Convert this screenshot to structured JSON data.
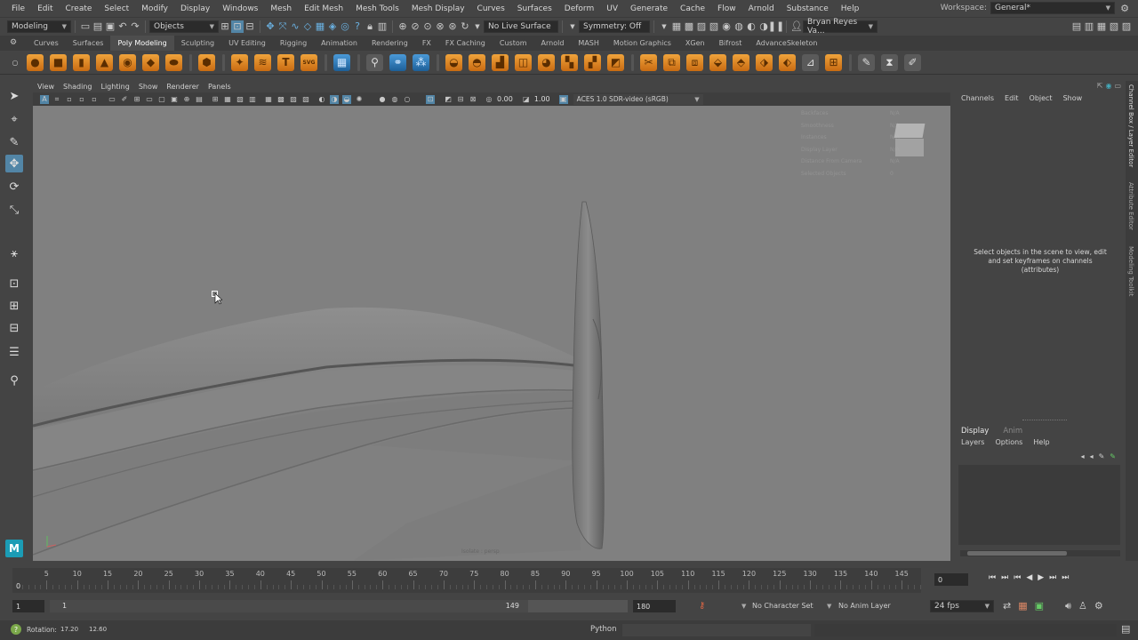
{
  "menubar": {
    "items": [
      "File",
      "Edit",
      "Create",
      "Select",
      "Modify",
      "Display",
      "Windows",
      "Mesh",
      "Edit Mesh",
      "Mesh Tools",
      "Mesh Display",
      "Curves",
      "Surfaces",
      "Deform",
      "UV",
      "Generate",
      "Cache",
      "Flow",
      "Arnold",
      "Substance",
      "Help"
    ],
    "workspace_label": "Workspace:",
    "workspace_value": "General*"
  },
  "statusline": {
    "menu_set": "Modeling",
    "selection_mode": "Objects",
    "live_surface": "No Live Surface",
    "symmetry": "Symmetry: Off",
    "user": "Bryan Reyes Va..."
  },
  "shelf": {
    "tabs": [
      "Curves",
      "Surfaces",
      "Poly Modeling",
      "Sculpting",
      "UV Editing",
      "Rigging",
      "Animation",
      "Rendering",
      "FX",
      "FX Caching",
      "Custom",
      "Arnold",
      "MASH",
      "Motion Graphics",
      "XGen",
      "Bifrost",
      "AdvanceSkeleton"
    ],
    "active_tab": "Poly Modeling",
    "text_icon": "T",
    "svg_icon": "SVG"
  },
  "panel": {
    "menus": [
      "View",
      "Shading",
      "Lighting",
      "Show",
      "Renderer",
      "Panels"
    ],
    "exposure": "0.00",
    "gamma": "1.00",
    "color_space": "ACES 1.0 SDR-video (sRGB)",
    "camera_label": "Isolate : persp"
  },
  "hud": {
    "rows": [
      "Backfaces",
      "Smoothness",
      "Instances",
      "Display Layer",
      "Distance From Camera",
      "Selected Objects"
    ],
    "values": [
      "N/A",
      "N/A",
      "N/A",
      "N/A",
      "N/A",
      "0"
    ]
  },
  "channelbox": {
    "menus": [
      "Channels",
      "Edit",
      "Object",
      "Show"
    ],
    "message": "Select objects in the scene to view, edit and set keyframes on channels (attributes)",
    "layer_tabs": [
      "Display",
      "Anim"
    ],
    "layer_menus": [
      "Layers",
      "Options",
      "Help"
    ],
    "vertical_tabs": [
      "Channel Box / Layer Editor",
      "Attribute Editor",
      "Modeling Toolkit"
    ]
  },
  "timeline": {
    "ticks": [
      5,
      10,
      15,
      20,
      25,
      30,
      35,
      40,
      45,
      50,
      55,
      60,
      65,
      70,
      75,
      80,
      85,
      90,
      95,
      100,
      105,
      110,
      115,
      120,
      125,
      130,
      135,
      140,
      145
    ],
    "start_label": "0",
    "current_frame": "0",
    "range_start": "1",
    "range_inner_start": "1",
    "range_inner_end": "149",
    "range_end": "180",
    "character_set": "No Character Set",
    "anim_layer": "No Anim Layer",
    "fps": "24 fps"
  },
  "helpline": {
    "label": "Rotation:",
    "value1": "17.20",
    "value2": "12.60",
    "script_lang": "Python"
  },
  "toolbox": {
    "logo": "M"
  }
}
